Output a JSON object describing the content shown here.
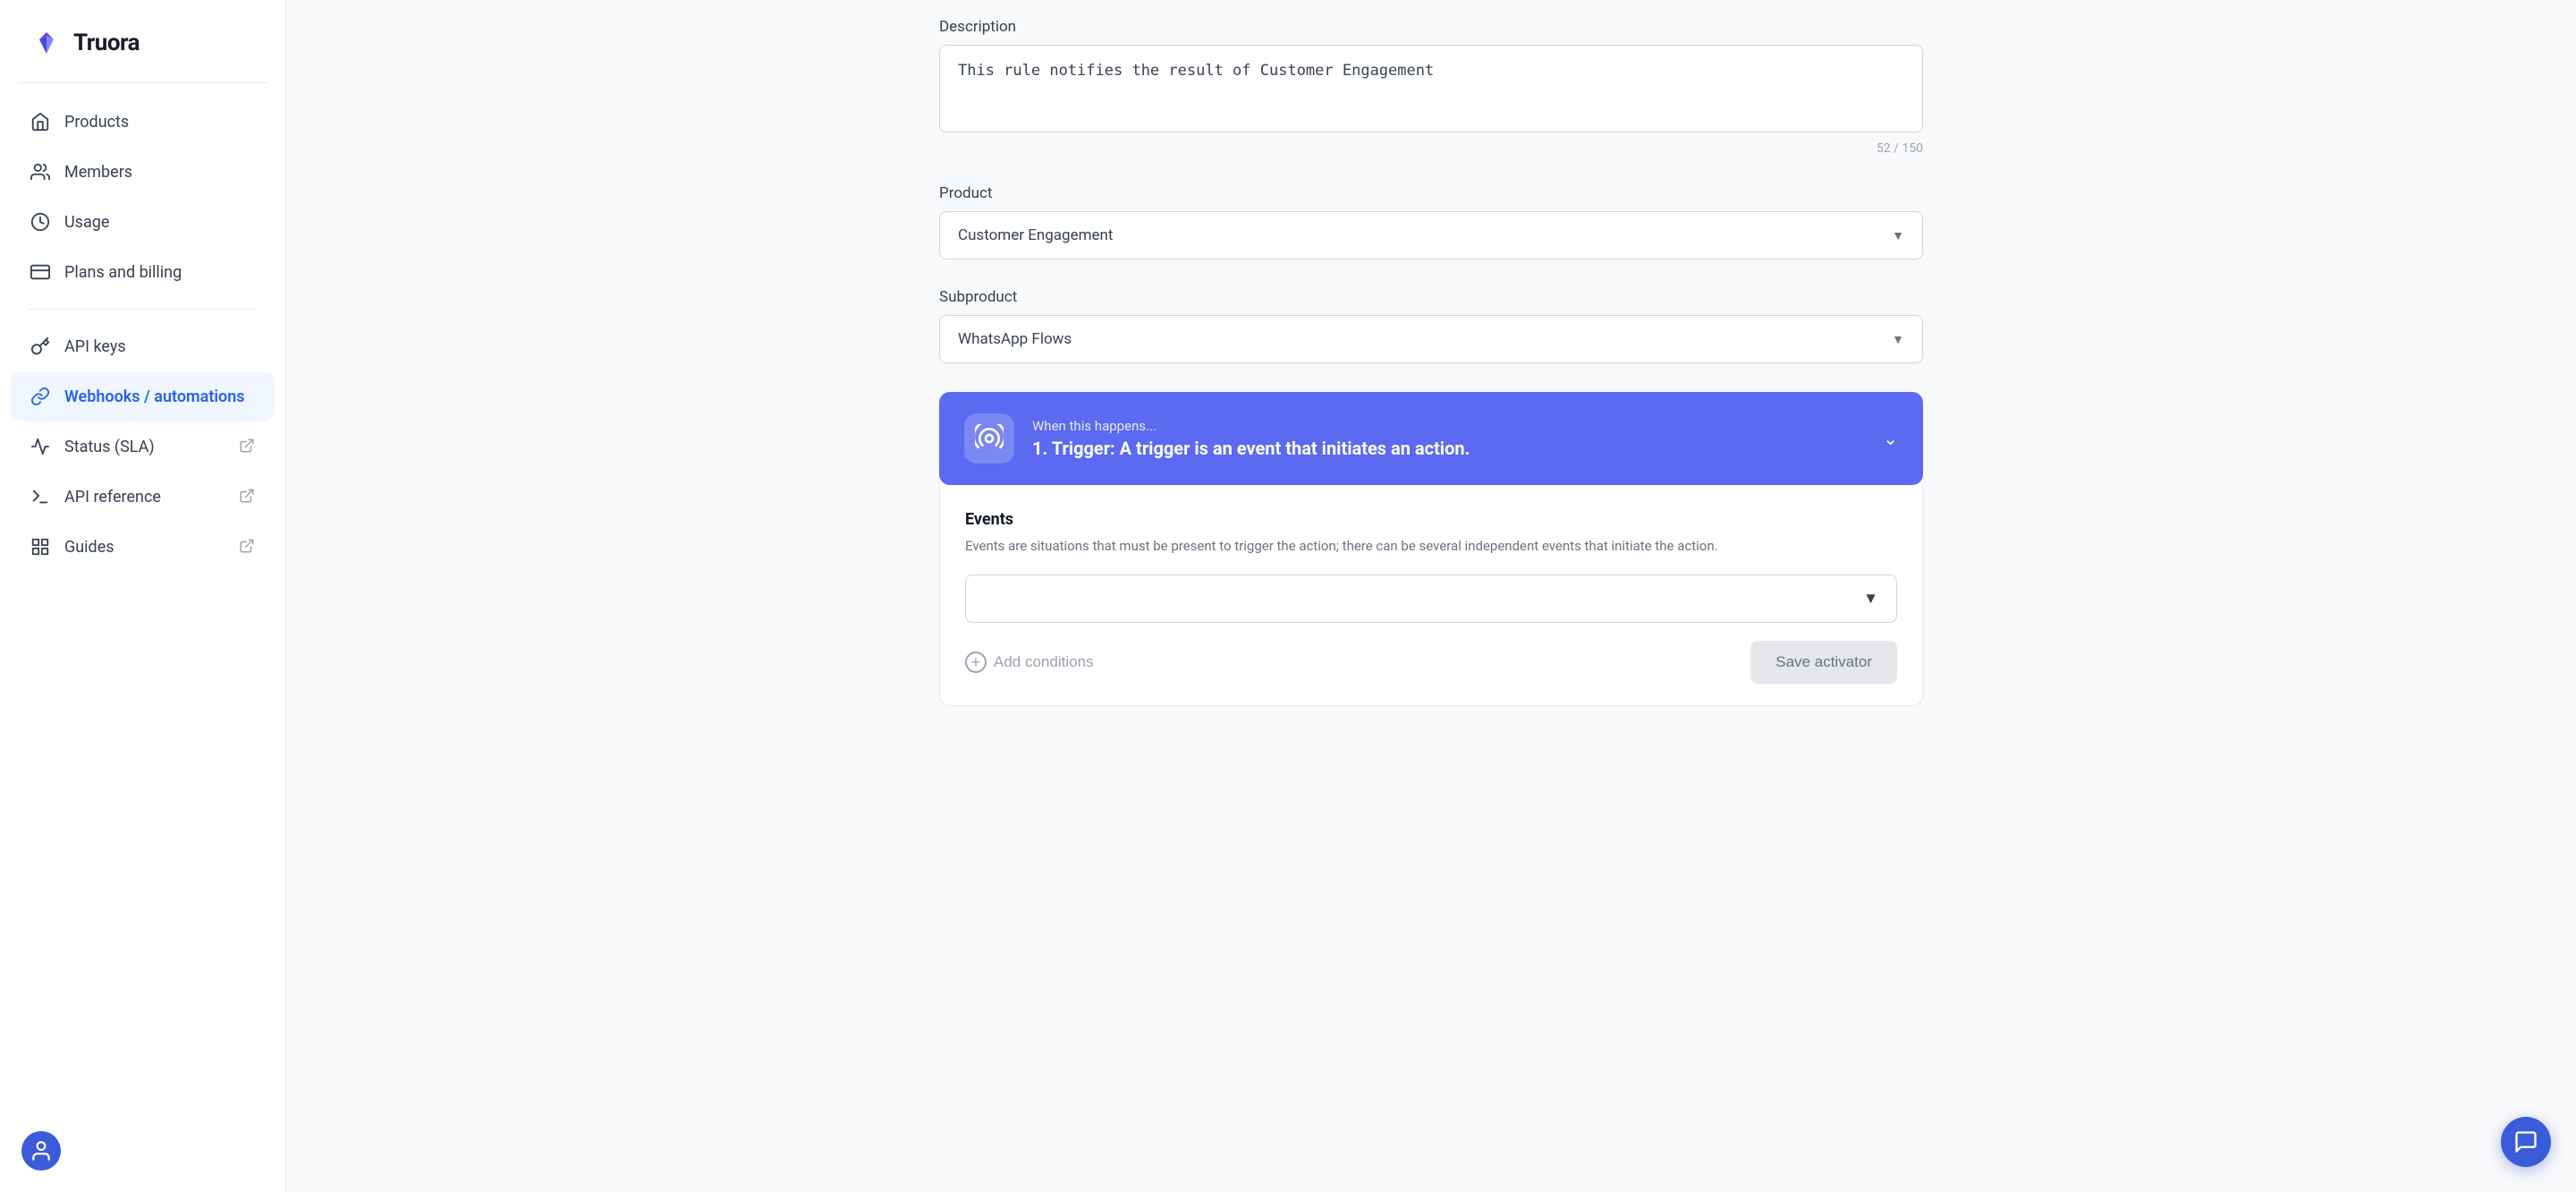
{
  "brand": {
    "logo_text": "Truora"
  },
  "sidebar": {
    "nav_items": [
      {
        "id": "products",
        "label": "Products",
        "icon": "home-icon",
        "active": false,
        "external": false
      },
      {
        "id": "members",
        "label": "Members",
        "icon": "members-icon",
        "active": false,
        "external": false
      },
      {
        "id": "usage",
        "label": "Usage",
        "icon": "usage-icon",
        "active": false,
        "external": false
      },
      {
        "id": "plans-billing",
        "label": "Plans and billing",
        "icon": "billing-icon",
        "active": false,
        "external": false
      },
      {
        "id": "api-keys",
        "label": "API keys",
        "icon": "api-icon",
        "active": false,
        "external": false
      },
      {
        "id": "webhooks",
        "label": "Webhooks / automations",
        "icon": "webhooks-icon",
        "active": true,
        "external": false
      },
      {
        "id": "status-sla",
        "label": "Status (SLA)",
        "icon": "status-icon",
        "active": false,
        "external": true
      },
      {
        "id": "api-reference",
        "label": "API reference",
        "icon": "api-ref-icon",
        "active": false,
        "external": true
      },
      {
        "id": "guides",
        "label": "Guides",
        "icon": "guides-icon",
        "active": false,
        "external": true
      }
    ]
  },
  "form": {
    "description_label": "Description",
    "description_value": "This rule notifies the result of Customer Engagement",
    "char_count": "52 / 150",
    "product_label": "Product",
    "product_value": "Customer Engagement",
    "subproduct_label": "Subproduct",
    "subproduct_value": "WhatsApp Flows",
    "trigger_subtitle": "When this happens...",
    "trigger_title": "1. Trigger: A trigger is an event that initiates an action.",
    "events_title": "Events",
    "events_desc": "Events are situations that must be present to trigger the action; there can be several independent events that initiate the action.",
    "events_select_placeholder": "",
    "add_conditions_label": "Add conditions",
    "save_activator_label": "Save activator"
  }
}
